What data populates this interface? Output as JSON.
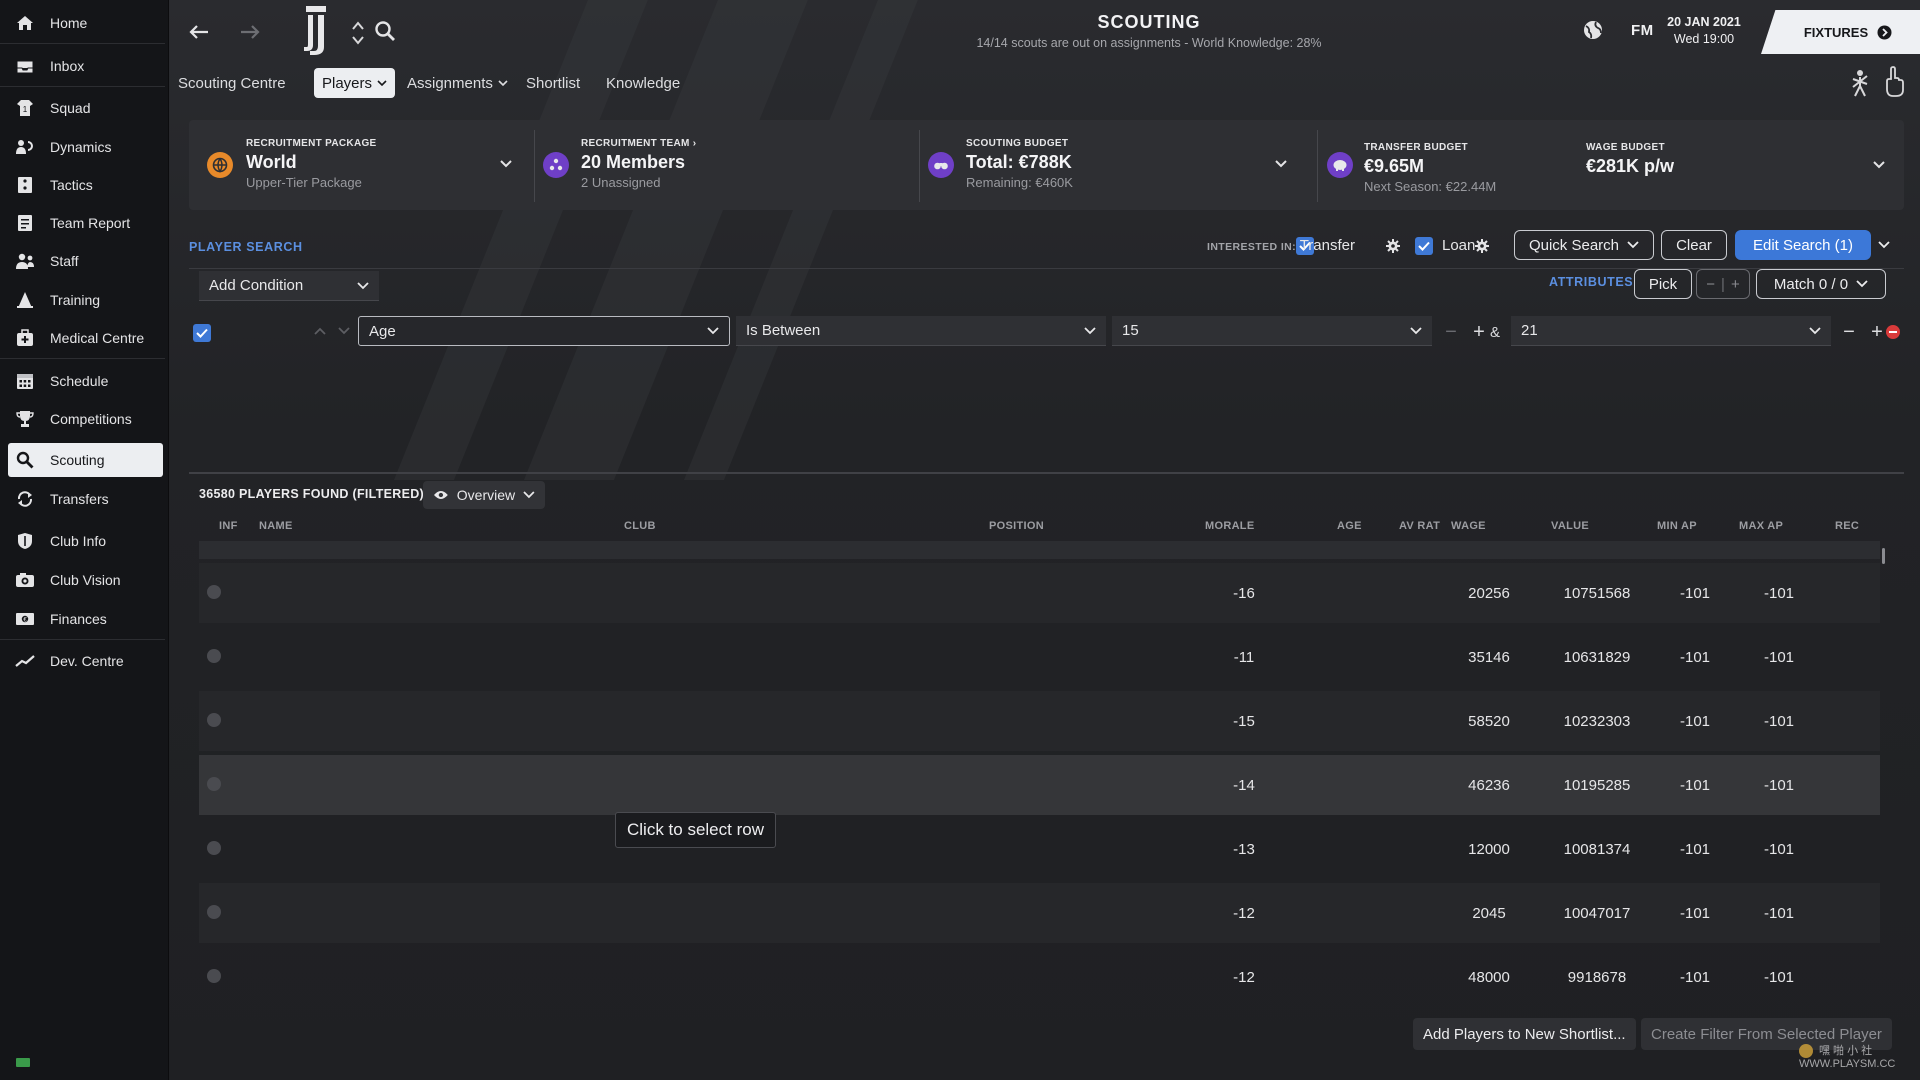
{
  "sidebar": {
    "items": [
      {
        "label": "Home",
        "icon": "home-icon"
      },
      {
        "label": "Inbox",
        "icon": "inbox-icon"
      },
      {
        "label": "Squad",
        "icon": "squad-icon"
      },
      {
        "label": "Dynamics",
        "icon": "dynamics-icon"
      },
      {
        "label": "Tactics",
        "icon": "tactics-icon"
      },
      {
        "label": "Team Report",
        "icon": "report-icon"
      },
      {
        "label": "Staff",
        "icon": "staff-icon"
      },
      {
        "label": "Training",
        "icon": "training-icon"
      },
      {
        "label": "Medical Centre",
        "icon": "medical-icon"
      },
      {
        "label": "Schedule",
        "icon": "calendar-icon"
      },
      {
        "label": "Competitions",
        "icon": "trophy-icon"
      },
      {
        "label": "Scouting",
        "icon": "search-icon"
      },
      {
        "label": "Transfers",
        "icon": "transfers-icon"
      },
      {
        "label": "Club Info",
        "icon": "shield-icon"
      },
      {
        "label": "Club Vision",
        "icon": "vision-icon"
      },
      {
        "label": "Finances",
        "icon": "money-icon"
      },
      {
        "label": "Dev. Centre",
        "icon": "dev-centre-icon"
      }
    ],
    "active": "Scouting"
  },
  "header": {
    "title": "SCOUTING",
    "subtitle": "14/14 scouts are out on assignments - World Knowledge: 28%",
    "date": "20 JAN 2021",
    "time": "Wed 19:00",
    "fm_logo": "FM",
    "fixtures_label": "FIXTURES"
  },
  "tabs": [
    {
      "label": "Scouting Centre"
    },
    {
      "label": "Players"
    },
    {
      "label": "Assignments"
    },
    {
      "label": "Shortlist"
    },
    {
      "label": "Knowledge"
    }
  ],
  "info": {
    "recruitment_package": {
      "label": "RECRUITMENT PACKAGE",
      "value": "World",
      "sub": "Upper-Tier Package"
    },
    "recruitment_team": {
      "label": "RECRUITMENT TEAM",
      "value": "20 Members",
      "sub": "2 Unassigned"
    },
    "scouting_budget": {
      "label": "SCOUTING BUDGET",
      "value": "Total: €788K",
      "sub": "Remaining: €460K"
    },
    "transfer_budget": {
      "label": "TRANSFER BUDGET",
      "value": "€9.65M",
      "sub": "Next Season: €22.44M"
    },
    "wage_budget": {
      "label": "WAGE BUDGET",
      "value": "€281K p/w"
    }
  },
  "search": {
    "title": "PLAYER SEARCH",
    "interested_in": "INTERESTED IN:",
    "transfer_label": "Transfer",
    "loan_label": "Loan",
    "quick_search": "Quick Search",
    "clear": "Clear",
    "edit_search": "Edit Search (1)",
    "add_condition": "Add Condition",
    "attributes": "ATTRIBUTES",
    "pick": "Pick",
    "match": "Match 0 / 0",
    "condition": {
      "field": "Age",
      "operator": "Is Between",
      "min": "15",
      "max": "21",
      "and": "&"
    }
  },
  "results": {
    "count_label": "36580 PLAYERS FOUND (FILTERED)",
    "view": "Overview",
    "columns": [
      "INF",
      "NAME",
      "CLUB",
      "POSITION",
      "MORALE",
      "AGE",
      "AV RAT",
      "WAGE",
      "VALUE",
      "MIN AP",
      "MAX AP",
      "REC"
    ],
    "rows": [
      {
        "morale": "-16",
        "wage": "20256",
        "value": "10751568",
        "min_ap": "-101",
        "max_ap": "-101"
      },
      {
        "morale": "-11",
        "wage": "35146",
        "value": "10631829",
        "min_ap": "-101",
        "max_ap": "-101"
      },
      {
        "morale": "-15",
        "wage": "58520",
        "value": "10232303",
        "min_ap": "-101",
        "max_ap": "-101"
      },
      {
        "morale": "-14",
        "wage": "46236",
        "value": "10195285",
        "min_ap": "-101",
        "max_ap": "-101"
      },
      {
        "morale": "-13",
        "wage": "12000",
        "value": "10081374",
        "min_ap": "-101",
        "max_ap": "-101"
      },
      {
        "morale": "-12",
        "wage": "2045",
        "value": "10047017",
        "min_ap": "-101",
        "max_ap": "-101"
      },
      {
        "morale": "-12",
        "wage": "48000",
        "value": "9918678",
        "min_ap": "-101",
        "max_ap": "-101"
      }
    ],
    "tooltip": "Click to select row"
  },
  "footer": {
    "add_shortlist": "Add Players to New Shortlist...",
    "create_filter": "Create Filter From Selected Player"
  },
  "watermark": "嘿 啪 小 社 WWW.PLAYSM.CC",
  "colors": {
    "accent": "#3c78d8",
    "link": "#5b8fe0",
    "purple": "#6f3fc7",
    "orange": "#e88a2a"
  }
}
